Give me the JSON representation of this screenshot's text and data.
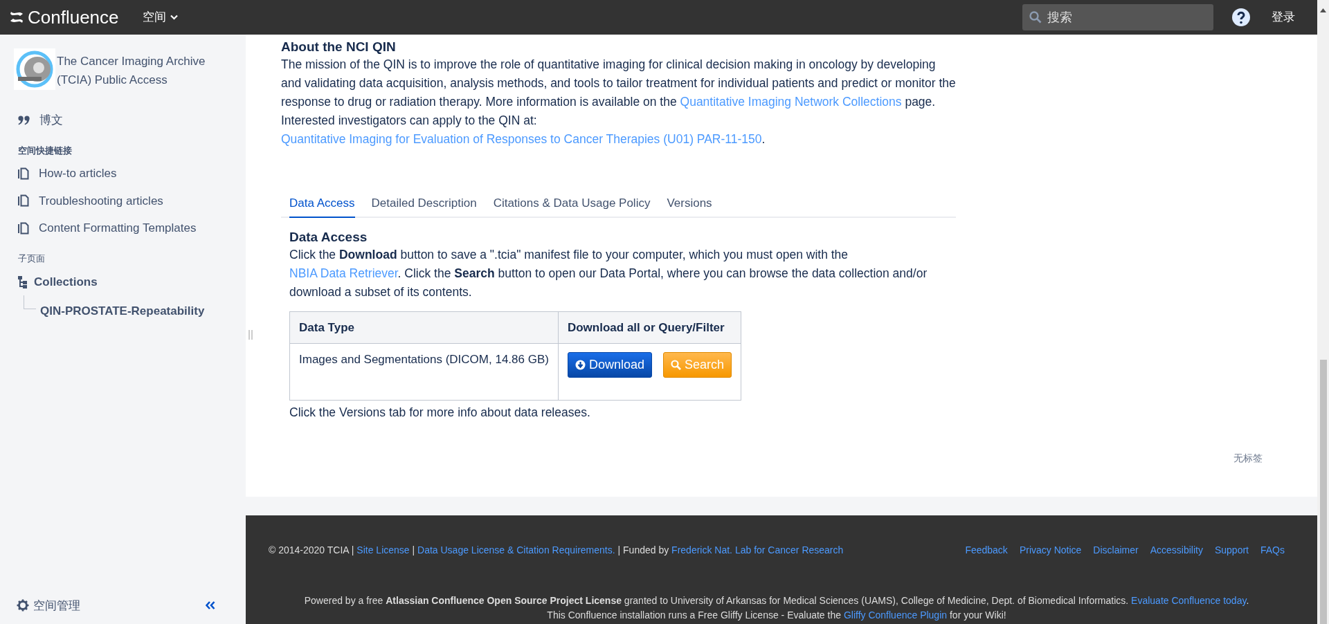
{
  "header": {
    "product": "Confluence",
    "spaces_menu": "空间",
    "search": {
      "placeholder": "搜索"
    },
    "login": "登录"
  },
  "sidebar": {
    "space_name": "The Cancer Imaging Archive (TCIA) Public Access",
    "blog": "博文",
    "shortcuts_heading": "空间快捷链接",
    "shortcuts": [
      "How-to articles",
      "Troubleshooting articles",
      "Content Formatting Templates"
    ],
    "children_heading": "子页面",
    "tree": [
      {
        "label": "Collections",
        "children": [
          {
            "label": "QIN-PROSTATE-Repeatability"
          }
        ]
      }
    ],
    "space_tools": "空间管理"
  },
  "main": {
    "about_heading": "About the NCI QIN",
    "about_text": [
      {
        "kind": "text",
        "text": "The mission of the QIN is to improve the role of quantitative imaging for clinical decision making in oncology by developing and validating data acquisition, analysis methods, and tools to tailor treatment for individual patients and predict or monitor the response to drug or radiation therapy. More information is available on the "
      },
      {
        "kind": "link",
        "text": "Quantitative Imaging Network Collections"
      },
      {
        "kind": "text",
        "text": " page. Interested investigators can apply to the QIN at: "
      },
      {
        "kind": "link",
        "text": "Quantitative Imaging for Evaluation of Responses to Cancer Therapies (U01) PAR-11-150"
      },
      {
        "kind": "text",
        "text": "."
      }
    ],
    "tabs": [
      {
        "label": "Data Access",
        "selected": true
      },
      {
        "label": "Detailed Description",
        "selected": false
      },
      {
        "label": "Citations & Data Usage Policy",
        "selected": false
      },
      {
        "label": "Versions",
        "selected": false
      }
    ],
    "data_access_heading": "Data Access",
    "data_access_text": [
      {
        "kind": "text",
        "text": "Click the **Download** button to save a \".tcia\" manifest file to your computer, which you must open with the "
      },
      {
        "kind": "link",
        "text": "NBIA Data Retriever"
      },
      {
        "kind": "text",
        "text": ". Click the **Search** button to open our Data Portal, where you can browse the data collection and/or download a subset of its contents."
      }
    ],
    "table": {
      "columns": [
        "Data Type",
        "Download all or Query/Filter"
      ],
      "rows": [
        {
          "data_type": "Images and Segmentations (DICOM, 14.86 GB)",
          "buttons": [
            {
              "label": "Download",
              "kind": "download"
            },
            {
              "label": "Search",
              "kind": "search"
            }
          ]
        }
      ]
    },
    "note": "Click the Versions tab for more info about data releases.",
    "labels": "无标签"
  },
  "footer": {
    "line": [
      {
        "kind": "text",
        "text": "© 2014-2020 TCIA | "
      },
      {
        "kind": "link",
        "text": "Site License"
      },
      {
        "kind": "text",
        "text": " | "
      },
      {
        "kind": "link",
        "text": "Data Usage License & Citation Requirements."
      },
      {
        "kind": "text",
        "text": " | Funded by "
      },
      {
        "kind": "link",
        "text": "Frederick Nat. Lab for Cancer Research"
      }
    ],
    "links": [
      "Feedback",
      "Privacy Notice",
      "Disclaimer",
      "Accessibility",
      "Support",
      "FAQs"
    ],
    "powered": [
      {
        "kind": "text",
        "text": "Powered by a free **Atlassian Confluence Open Source Project License** granted to University of Arkansas for Medical Sciences (UAMS), College of Medicine, Dept. of Biomedical Informatics. "
      },
      {
        "kind": "link",
        "text": "Evaluate Confluence today"
      },
      {
        "kind": "text",
        "text": "."
      }
    ],
    "gliffy": [
      {
        "kind": "text",
        "text": "This Confluence installation runs a Free Gliffy License - Evaluate the "
      },
      {
        "kind": "link",
        "text": "Gliffy Confluence Plugin"
      },
      {
        "kind": "text",
        "text": " for your Wiki!"
      }
    ]
  }
}
